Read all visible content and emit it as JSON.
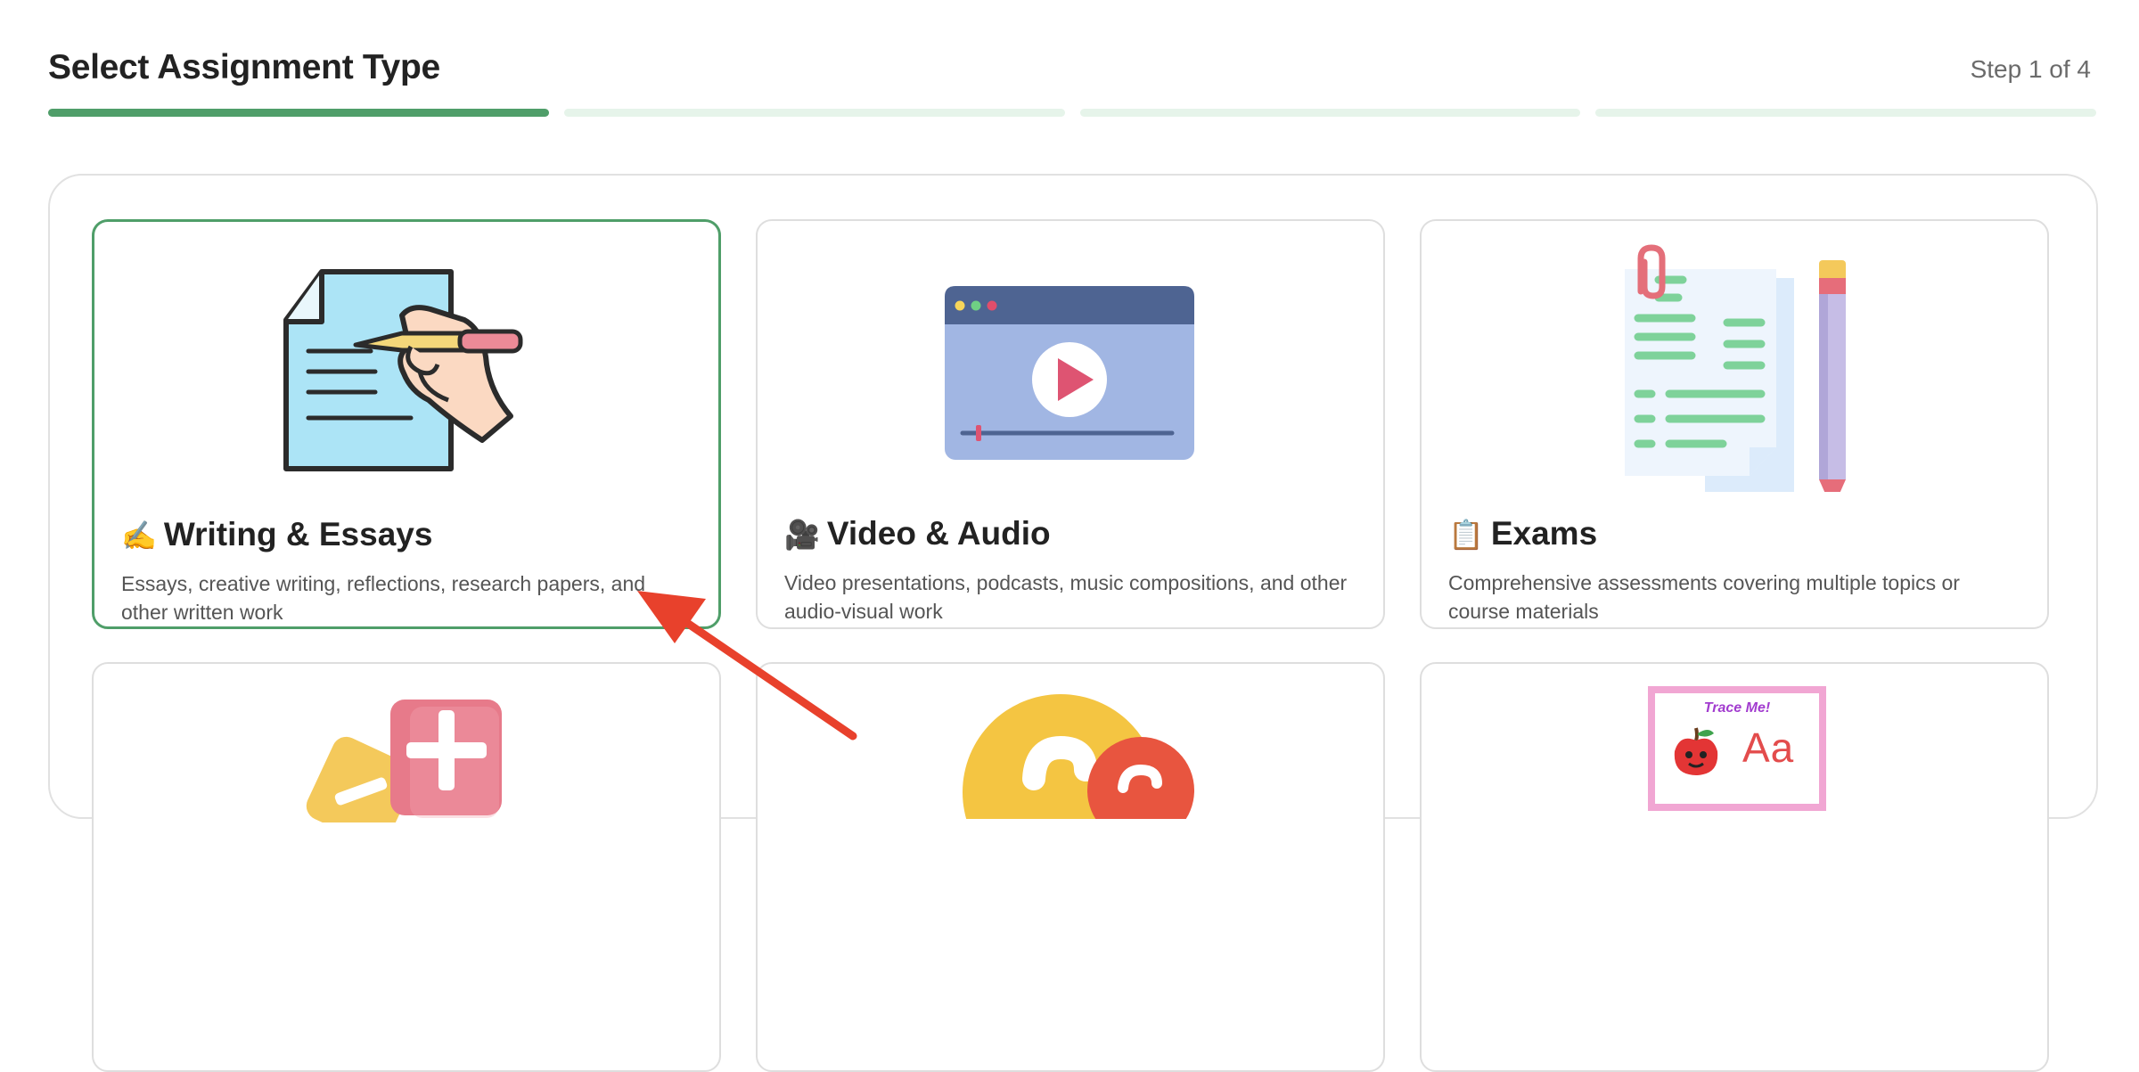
{
  "header": {
    "title": "Select Assignment Type",
    "step_text": "Step 1 of 4"
  },
  "progress": {
    "current_step": 1,
    "total_steps": 4
  },
  "cards": [
    {
      "emoji": "✍️",
      "title": "Writing & Essays",
      "description": "Essays, creative writing, reflections, research papers, and other written work",
      "selected": true
    },
    {
      "emoji": "🎥",
      "title": "Video & Audio",
      "description": "Video presentations, podcasts, music compositions, and other audio-visual work",
      "selected": false
    },
    {
      "emoji": "📋",
      "title": "Exams",
      "description": "Comprehensive assessments covering multiple topics or course materials",
      "selected": false
    }
  ],
  "worksheet": {
    "trace_label": "Trace Me!",
    "letters": "Aa"
  },
  "colors": {
    "accent": "#4f9e69",
    "accent_light": "#e6f4ea",
    "annotation_arrow": "#e8412c"
  }
}
